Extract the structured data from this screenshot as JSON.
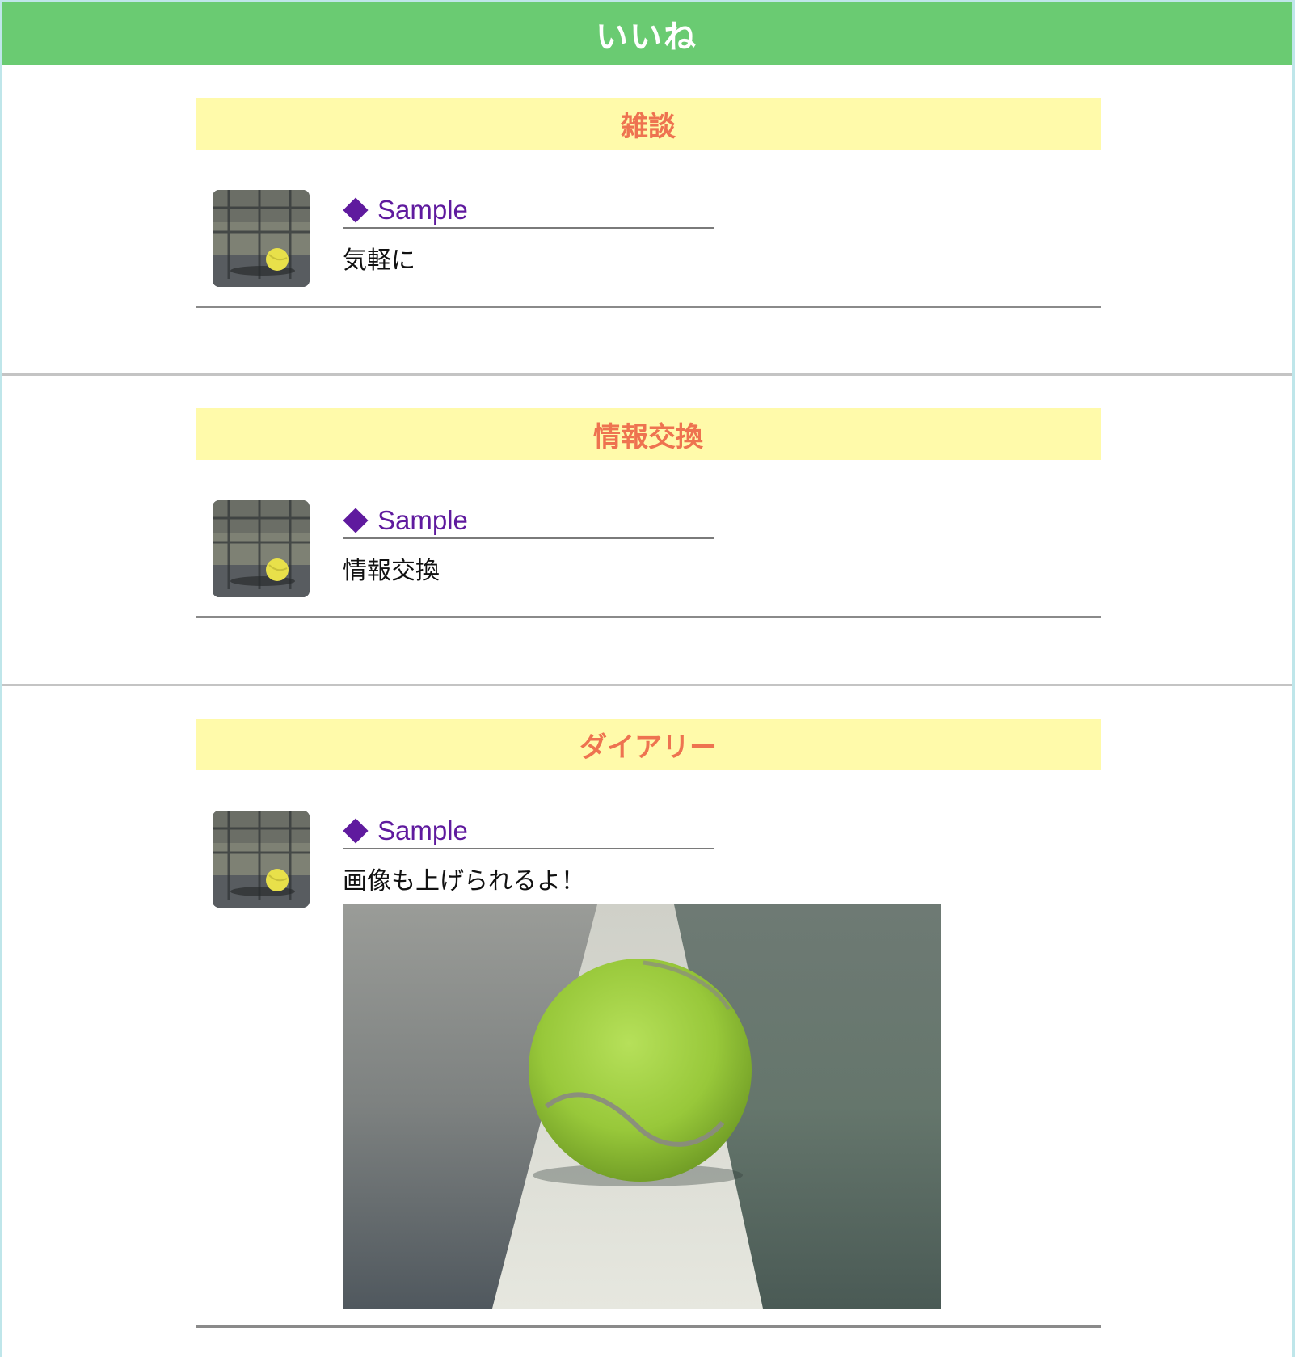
{
  "header": {
    "title": "いいね"
  },
  "sections": [
    {
      "category": "雑談",
      "post": {
        "author": "Sample",
        "text": "気軽に",
        "has_image": false
      }
    },
    {
      "category": "情報交換",
      "post": {
        "author": "Sample",
        "text": "情報交換",
        "has_image": false
      }
    },
    {
      "category": "ダイアリー",
      "post": {
        "author": "Sample",
        "text": "画像も上げられるよ！",
        "has_image": true
      }
    }
  ],
  "colors": {
    "header_bg": "#6acb72",
    "category_bg": "#fffaaa",
    "category_text": "#ee7350",
    "author_text": "#5f1a9e"
  }
}
